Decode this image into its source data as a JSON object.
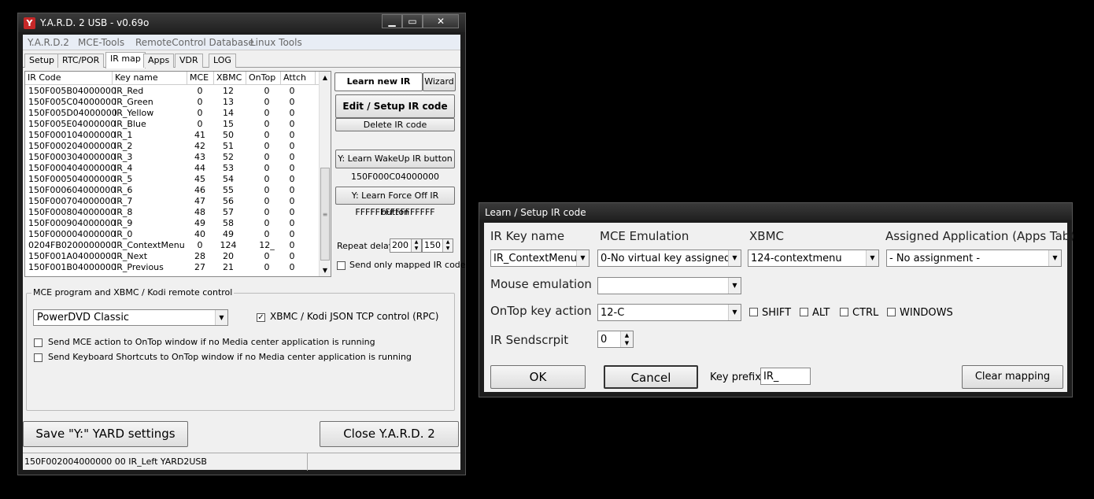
{
  "main_window": {
    "title": "Y.A.R.D. 2 USB - v0.69o",
    "logo_letter": "Y",
    "caption": {
      "minimize": "▁",
      "maximize": "▭",
      "close": "✕"
    },
    "menu": [
      "Y.A.R.D.2",
      "MCE-Tools",
      "RemoteControl Database",
      "Linux Tools"
    ],
    "tabs": [
      "Setup",
      "RTC/POR",
      "IR map",
      "Apps",
      "VDR",
      "LOG"
    ],
    "active_tab": "IR map",
    "table": {
      "headers": [
        "IR Code",
        "Key name",
        "MCE",
        "XBMC",
        "OnTop",
        "Attch"
      ],
      "rows": [
        [
          "150F005B04000000",
          "IR_Red",
          "0",
          "12",
          "0",
          "0"
        ],
        [
          "150F005C04000000",
          "IR_Green",
          "0",
          "13",
          "0",
          "0"
        ],
        [
          "150F005D04000000",
          "IR_Yellow",
          "0",
          "14",
          "0",
          "0"
        ],
        [
          "150F005E04000000",
          "IR_Blue",
          "0",
          "15",
          "0",
          "0"
        ],
        [
          "150F000104000000",
          "IR_1",
          "41",
          "50",
          "0",
          "0"
        ],
        [
          "150F000204000000",
          "IR_2",
          "42",
          "51",
          "0",
          "0"
        ],
        [
          "150F000304000000",
          "IR_3",
          "43",
          "52",
          "0",
          "0"
        ],
        [
          "150F000404000000",
          "IR_4",
          "44",
          "53",
          "0",
          "0"
        ],
        [
          "150F000504000000",
          "IR_5",
          "45",
          "54",
          "0",
          "0"
        ],
        [
          "150F000604000000",
          "IR_6",
          "46",
          "55",
          "0",
          "0"
        ],
        [
          "150F000704000000",
          "IR_7",
          "47",
          "56",
          "0",
          "0"
        ],
        [
          "150F000804000000",
          "IR_8",
          "48",
          "57",
          "0",
          "0"
        ],
        [
          "150F000904000000",
          "IR_9",
          "49",
          "58",
          "0",
          "0"
        ],
        [
          "150F000004000000",
          "IR_0",
          "40",
          "49",
          "0",
          "0"
        ],
        [
          "0204FB0200000000",
          "IR_ContextMenu",
          "0",
          "124",
          "12_",
          "0"
        ],
        [
          "150F001A04000000",
          "IR_Next",
          "28",
          "20",
          "0",
          "0"
        ],
        [
          "150F001B04000000",
          "IR_Previous",
          "27",
          "21",
          "0",
          "0"
        ]
      ]
    },
    "side": {
      "learn_new": "Learn new IR code",
      "wizard": "Wizard",
      "edit_setup": "Edit / Setup IR code",
      "delete": "Delete IR code",
      "learn_wakeup": "Y: Learn WakeUp IR button",
      "wakeup_code": "150F000C04000000",
      "learn_forceoff": "Y: Learn Force Off IR button",
      "forceoff_code": "FFFFFFFFFFFFFFFF",
      "repeat_label": "Repeat delay",
      "repeat_1": "200",
      "repeat_2": "150",
      "send_only_mapped": "Send only mapped IR code",
      "send_only_mapped_checked": false
    },
    "mce_group": {
      "title": "MCE program and XBMC / Kodi remote control",
      "program": "PowerDVD Classic",
      "json_rpc_label": "XBMC / Kodi JSON TCP control (RPC)",
      "json_rpc_checked": true,
      "send_mce_label": "Send MCE action to OnTop window if no Media center application is running",
      "send_kbd_label": "Send Keyboard Shortcuts to OnTop window if no Media center application is running"
    },
    "save_button": "Save \"Y:\" YARD settings",
    "close_button": "Close Y.A.R.D. 2",
    "status": "150F002004000000 00 IR_Left YARD2USB"
  },
  "dialog": {
    "title": "Learn / Setup IR code",
    "labels": {
      "ir_key_name": "IR Key name",
      "mce_emulation": "MCE Emulation",
      "xbmc": "XBMC",
      "assigned_app": "Assigned Application (Apps Tab)",
      "mouse_emulation": "Mouse emulation",
      "ontop_key_action": "OnTop key action",
      "ir_sendscript": "IR Sendscrpit",
      "key_prefix": "Key prefix"
    },
    "values": {
      "ir_key_name": "IR_ContextMenu",
      "mce_emulation": "0-No virtual key assigned",
      "xbmc": "124-contextmenu",
      "assigned_app": "- No assignment -",
      "mouse_emulation": "",
      "ontop_key_action": "12-C",
      "ir_sendscript": "0",
      "key_prefix": "IR_"
    },
    "modifiers": [
      "SHIFT",
      "ALT",
      "CTRL",
      "WINDOWS"
    ],
    "ok": "OK",
    "cancel": "Cancel",
    "clear_mapping": "Clear mapping"
  }
}
